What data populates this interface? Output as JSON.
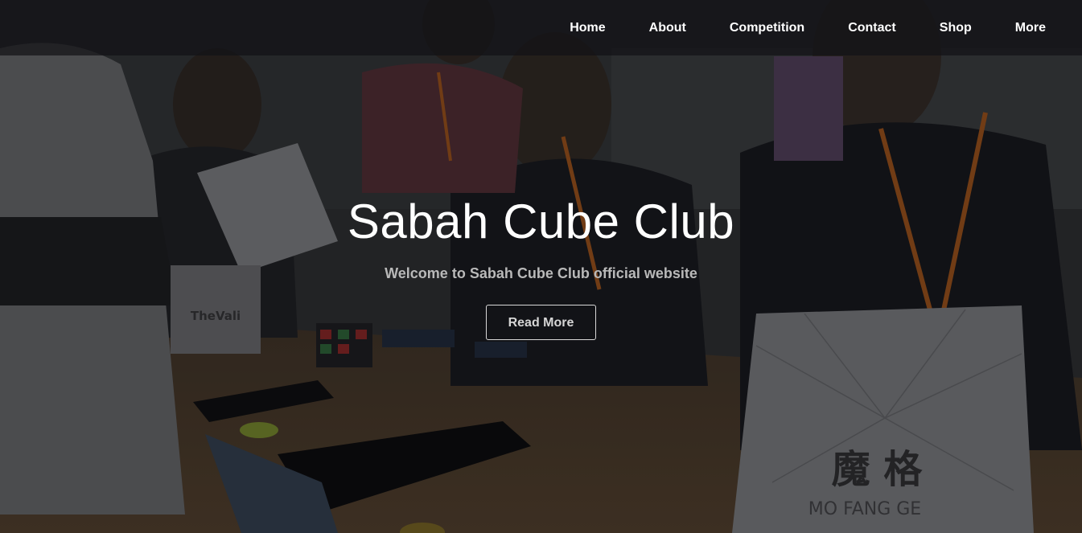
{
  "nav": {
    "items": [
      {
        "label": "Home"
      },
      {
        "label": "About"
      },
      {
        "label": "Competition"
      },
      {
        "label": "Contact"
      },
      {
        "label": "Shop"
      },
      {
        "label": "More"
      }
    ]
  },
  "hero": {
    "title": "Sabah Cube Club",
    "subtitle": "Welcome to Sabah Cube Club official website",
    "button_label": "Read More"
  },
  "background": {
    "description_icon": "cube-competition-photo",
    "overlay_color": "#000000"
  }
}
